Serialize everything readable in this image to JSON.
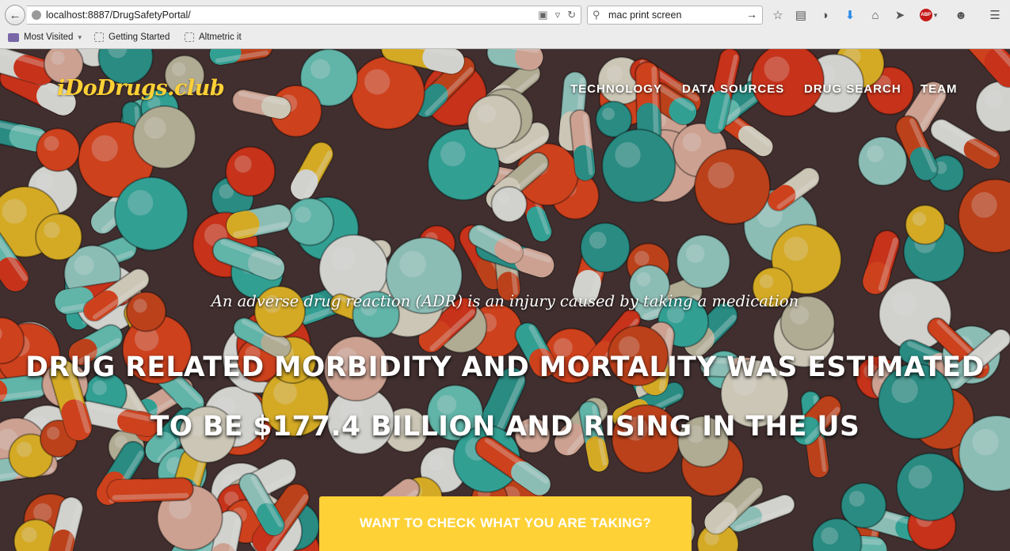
{
  "browser": {
    "url": "localhost:8887/DrugSafetyPortal/",
    "search_text": "mac print screen",
    "bookmarks": [
      "Most Visited",
      "Getting Started",
      "Altmetric it"
    ],
    "toolbar_icons": [
      "star-icon",
      "reading-list-icon",
      "pocket-icon",
      "download-icon",
      "home-icon",
      "send-icon",
      "adblock-plus-icon",
      "smiley-icon",
      "menu-icon"
    ],
    "abp_label": "ABP"
  },
  "page": {
    "brand": "iDoDrugs.club",
    "nav": [
      "TECHNOLOGY",
      "DATA SOURCES",
      "DRUG SEARCH",
      "TEAM"
    ],
    "lead": "An adverse drug reaction (ADR) is an injury caused by taking a medication",
    "headline_line1": "DRUG RELATED MORBIDITY AND MORTALITY WAS ESTIMATED",
    "headline_line2": "TO BE $177.4 BILLION AND RISING IN THE US",
    "cta": "WANT TO CHECK WHAT YOU ARE TAKING?",
    "accent_color": "#fed136"
  }
}
